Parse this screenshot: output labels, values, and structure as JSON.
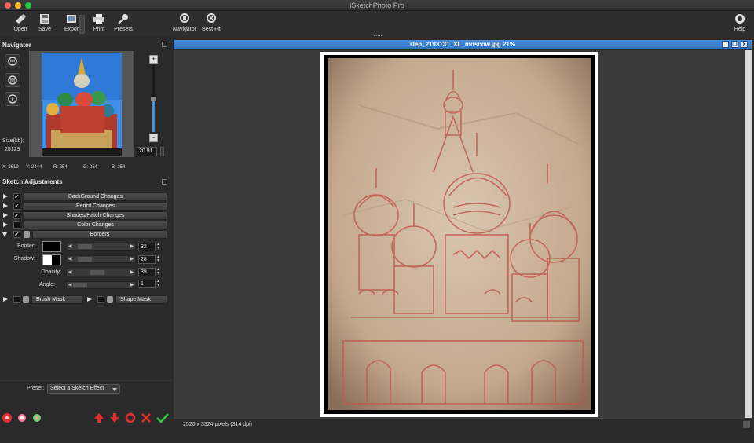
{
  "window": {
    "title": "iSketchPhoto Pro"
  },
  "toolbar": {
    "open": "Open",
    "save": "Save",
    "export": "Export",
    "print": "Print",
    "presets": "Presets",
    "navigator": "Navigator",
    "best_fit": "Best Fit",
    "help": "Help"
  },
  "navigator": {
    "title": "Navigator",
    "size_label": "Size(kb):",
    "size_value": "25129",
    "zoom_value": "20.91",
    "zoom_plus": "+",
    "zoom_minus": "-",
    "readout": {
      "x": "X: 2619",
      "y": "Y: 2444",
      "r": "R: 254",
      "g": "G: 254",
      "b": "B: 254"
    }
  },
  "sketch_adjustments": {
    "title": "Sketch Adjustments",
    "rows": [
      {
        "label": "BackGround Changes",
        "checked": true
      },
      {
        "label": "Pencil Changes",
        "checked": true
      },
      {
        "label": "Shades/Hatch Changes",
        "checked": true
      },
      {
        "label": "Color Changes",
        "checked": false
      },
      {
        "label": "Borders",
        "checked": true
      }
    ],
    "borders": {
      "border_label": "Border:",
      "border_color": "#000000",
      "border_value": "32",
      "shadow_label": "Shadow:",
      "shadow_color": "#ffffff",
      "shadow_value": "28",
      "opacity_label": "Opacity:",
      "opacity_value": "39",
      "angle_label": "Angle:",
      "angle_value": "1"
    },
    "brush_mask": "Brush Mask",
    "shape_mask": "Shape Mask"
  },
  "preset": {
    "label": "Preset:",
    "value": "Select a Sketch Effect"
  },
  "document": {
    "title": "Dep_2193131_XL_moscow.jpg 21%",
    "status": "2520 x 3324 pixels (314 dpi)"
  },
  "colors": {
    "accent": "#2b6fc2",
    "sketch": "#c05a4e",
    "paper": "#d9c2a8",
    "ok": "#37c64a",
    "cancel": "#e0312a"
  }
}
